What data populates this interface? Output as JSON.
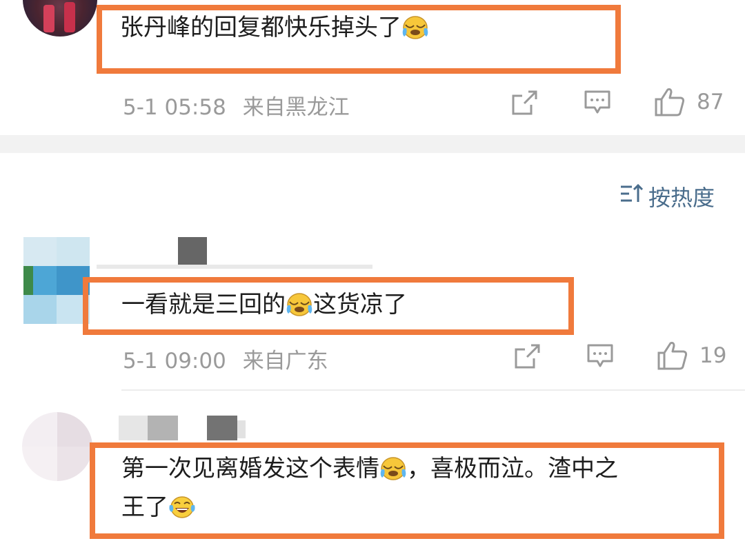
{
  "comments": [
    {
      "text": "张丹峰的回复都快乐掉头了",
      "time": "5-1 05:58",
      "location": "来自黑龙江",
      "likes": "87"
    },
    {
      "text_part1": "一看就是三回的",
      "text_part2": "这货凉了",
      "time": "5-1 09:00",
      "location": "来自广东",
      "likes": "19"
    },
    {
      "line1_part1": "第一次见离婚发这个表情",
      "line1_part2": "，喜极而泣。渣中之",
      "line2": "王了"
    }
  ],
  "sort": {
    "label": "按热度"
  },
  "colors": {
    "highlight_frame": "#f07a3c",
    "meta_text": "#9a9a9a",
    "sort_text": "#4a6d8c"
  },
  "icons": [
    "share-icon",
    "comment-icon",
    "like-icon",
    "sort-icon",
    "crying-laugh-emoji",
    "tears-of-joy-emoji"
  ]
}
